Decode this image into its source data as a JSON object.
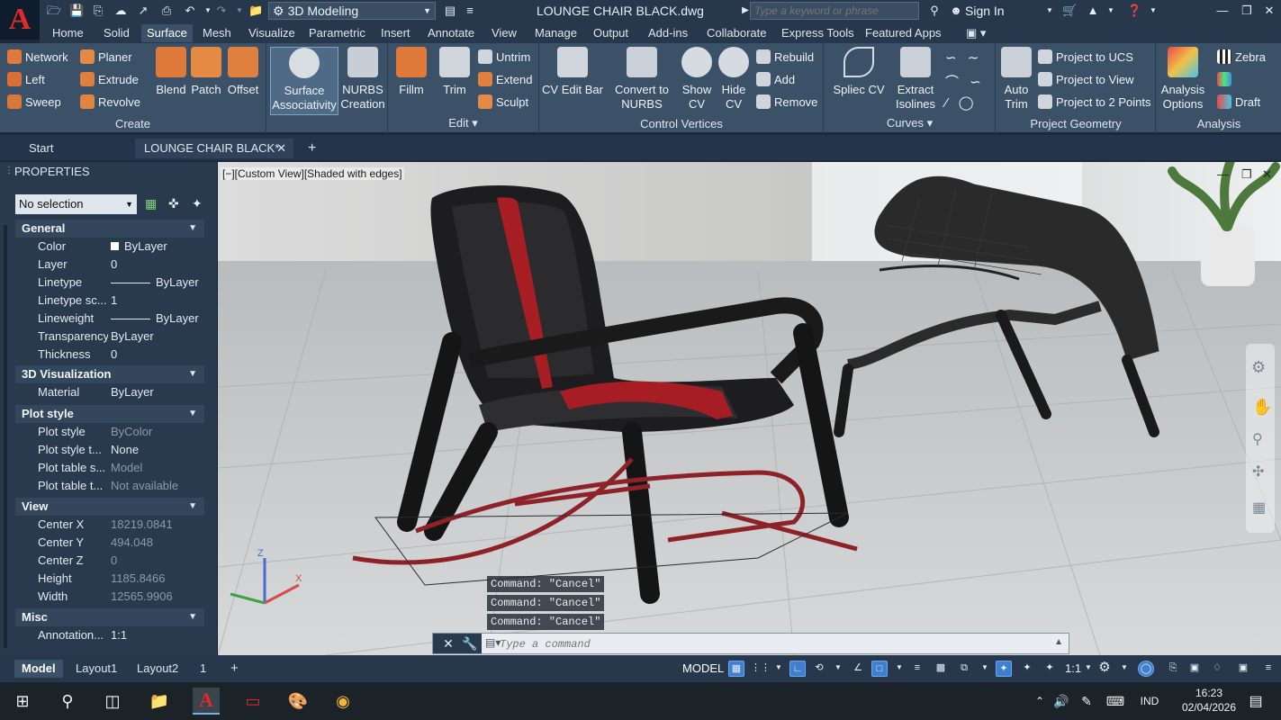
{
  "titlebar": {
    "app_logo": "A",
    "workspace": "3D Modeling",
    "doc_title": "LOUNGE CHAIR BLACK.dwg",
    "search_placeholder": "Type a keyword or phrase",
    "sign_in": "Sign In"
  },
  "ribbon_tabs": [
    "Home",
    "Solid",
    "Surface",
    "Mesh",
    "Visualize",
    "Parametric",
    "Insert",
    "Annotate",
    "View",
    "Manage",
    "Output",
    "Add-ins",
    "Collaborate",
    "Express Tools",
    "Featured Apps"
  ],
  "ribbon": {
    "create": {
      "label": "Create",
      "small": [
        "Network",
        "Planer",
        "Left",
        "Extrude",
        "Sweep",
        "Revolve"
      ],
      "large": [
        "Blend",
        "Patch",
        "Offset"
      ],
      "surface_assoc": [
        "Surface",
        "Associativity"
      ],
      "nurbs": [
        "NURBS",
        "Creation"
      ]
    },
    "edit": {
      "label": "Edit",
      "fillm": "Fillm",
      "trim": "Trim",
      "small": [
        "Untrim",
        "Extend",
        "Sculpt"
      ]
    },
    "control_vertices": {
      "label": "Control Vertices",
      "cv_edit_bar": "CV Edit Bar",
      "convert": [
        "Convert to",
        "NURBS"
      ],
      "show_cv": [
        "Show",
        "CV"
      ],
      "hide_cv": [
        "Hide",
        "CV"
      ],
      "small": [
        "Rebuild",
        "Add",
        "Remove"
      ]
    },
    "curves": {
      "label": "Curves",
      "spline_cv": "Spliec CV",
      "extract": [
        "Extract",
        "Isolines"
      ]
    },
    "project_geometry": {
      "label": "Project Geometry",
      "auto_trim": [
        "Auto",
        "Trim"
      ],
      "small": [
        "Project to UCS",
        "Project to View",
        "Project to 2 Points"
      ]
    },
    "analysis": {
      "label": "Analysis",
      "options": [
        "Analysis",
        "Options"
      ],
      "small": [
        "Zebra",
        "Draft"
      ]
    }
  },
  "doc_tabs": {
    "start": "Start",
    "drawing": "LOUNGE CHAIR BLACK*"
  },
  "properties": {
    "title": "PROPERTIES",
    "selection": "No selection",
    "sections": {
      "general": {
        "title": "General",
        "rows": [
          {
            "k": "Color",
            "v": "ByLayer"
          },
          {
            "k": "Layer",
            "v": "0"
          },
          {
            "k": "Linetype",
            "v": "ByLayer"
          },
          {
            "k": "Linetype sc...",
            "v": "1"
          },
          {
            "k": "Lineweight",
            "v": "ByLayer"
          },
          {
            "k": "Transparency",
            "v": "ByLayer"
          },
          {
            "k": "Thickness",
            "v": "0"
          }
        ]
      },
      "viz": {
        "title": "3D Visualization",
        "rows": [
          {
            "k": "Material",
            "v": "ByLayer"
          }
        ]
      },
      "plot": {
        "title": "Plot style",
        "rows": [
          {
            "k": "Plot style",
            "v": "ByColor"
          },
          {
            "k": "Plot style t...",
            "v": "None"
          },
          {
            "k": "Plot table s...",
            "v": "Model"
          },
          {
            "k": "Plot table t...",
            "v": "Not available"
          }
        ]
      },
      "view": {
        "title": "View",
        "rows": [
          {
            "k": "Center X",
            "v": "18219.0841"
          },
          {
            "k": "Center Y",
            "v": "494.048"
          },
          {
            "k": "Center Z",
            "v": "0"
          },
          {
            "k": "Height",
            "v": "1185.8466"
          },
          {
            "k": "Width",
            "v": "12565.9906"
          }
        ]
      },
      "misc": {
        "title": "Misc",
        "rows": [
          {
            "k": "Annotation...",
            "v": "1:1"
          }
        ]
      }
    }
  },
  "viewport": {
    "label": "[−][Custom View][Shaded with edges]",
    "ucs_x": "X",
    "ucs_z": "Z"
  },
  "command": {
    "history": [
      "Command: \"Cancel\"",
      "Command: \"Cancel\"",
      "Command: \"Cancel\""
    ],
    "placeholder": "Type a command"
  },
  "layout_tabs": [
    "Model",
    "Layout1",
    "Layout2",
    "1"
  ],
  "status": {
    "model": "MODEL",
    "scale": "1:1"
  },
  "taskbar": {
    "lang": "IND",
    "time": "16:23",
    "date": "02/04/2026"
  },
  "colors": {
    "accent_red": "#e02b2b",
    "ribbon_bg": "#3b5168",
    "title_bg": "#27384d",
    "stripe_red": "#a61e24"
  }
}
